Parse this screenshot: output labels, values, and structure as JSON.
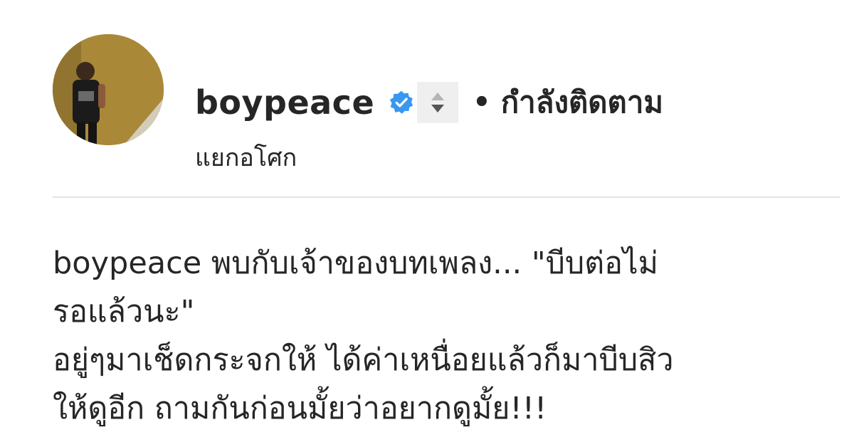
{
  "header": {
    "username": "boypeace",
    "separator": "•",
    "follow_status": "กำลังติดตาม",
    "location": "แยกอโศก",
    "verified_color": "#3897f0"
  },
  "icons": {
    "verified": "verified-badge-icon",
    "sort": "sort-arrows-icon"
  },
  "caption": {
    "username": "boypeace",
    "line1": "พบกับเจ้าของบทเพลง... \"บีบต่อไม่",
    "line2": "รอแล้วนะ\"",
    "line3": "อยู่ๆมาเช็ดกระจกให้ ได้ค่าเหนื่อยแล้วก็มาบีบสิว",
    "line4": "ให้ดูอีก ถามกันก่อนมั้ยว่าอยากดูมั้ย!!!"
  }
}
